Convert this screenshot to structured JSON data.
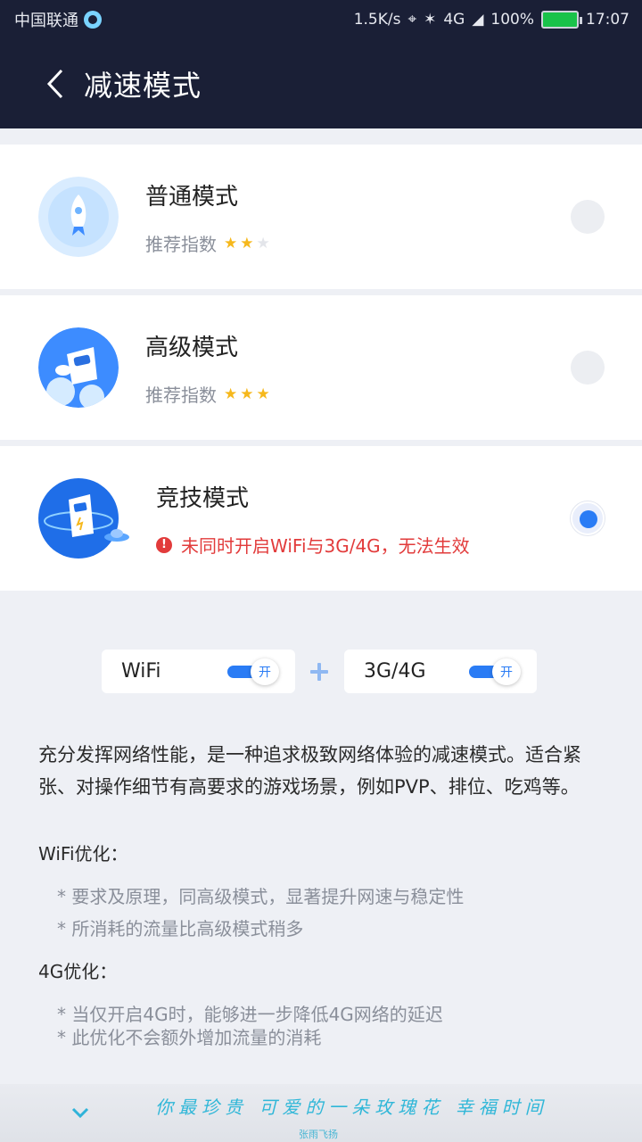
{
  "status_bar": {
    "carrier": "中国联通",
    "speed": "1.5K/s",
    "network": "4G",
    "battery": "100%",
    "time": "17:07"
  },
  "header": {
    "title": "减速模式"
  },
  "modes": [
    {
      "name": "普通模式",
      "recommend_label": "推荐指数",
      "stars": 2,
      "max_stars": 3,
      "selected": false
    },
    {
      "name": "高级模式",
      "recommend_label": "推荐指数",
      "stars": 3,
      "max_stars": 3,
      "selected": false
    },
    {
      "name": "竞技模式",
      "warning": "未同时开启WiFi与3G/4G，无法生效",
      "selected": true
    }
  ],
  "toggles": {
    "wifi_label": "WiFi",
    "wifi_state": "开",
    "cellular_label": "3G/4G",
    "cellular_state": "开"
  },
  "description": {
    "intro": "充分发挥网络性能，是一种追求极致网络体验的减速模式。适合紧张、对操作细节有高要求的游戏场景，例如PVP、排位、吃鸡等。",
    "wifi_title": "WiFi优化：",
    "wifi_points": [
      "* 要求及原理，同高级模式，显著提升网速与稳定性",
      "* 所消耗的流量比高级模式稍多"
    ],
    "cellular_title": "4G优化：",
    "cellular_points": [
      "* 当仅开启4G时，能够进一步降低4G网络的延迟",
      "* 此优化不会额外增加流量的消耗"
    ]
  },
  "music_overlay": {
    "lyric_main": "你最珍贵 可爱的一朵玫瑰花 幸福时间",
    "lyric_sub": "张雨飞扬"
  },
  "colors": {
    "header_bg": "#1a1f36",
    "accent": "#2a7cf5",
    "warning": "#e23b3b",
    "star": "#f6b81c"
  }
}
